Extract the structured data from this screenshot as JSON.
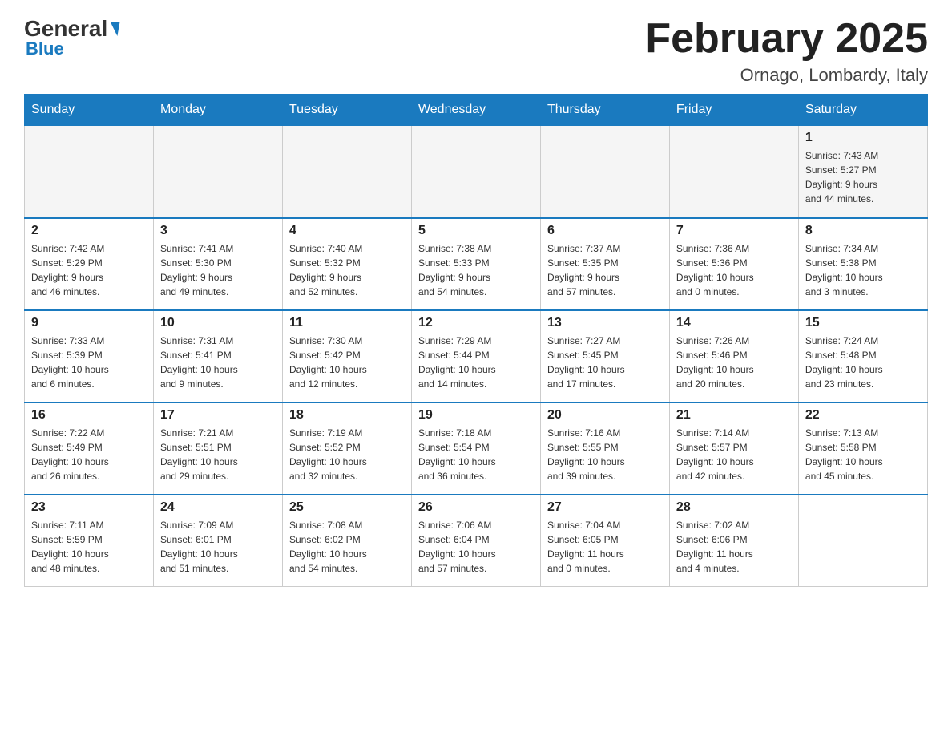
{
  "header": {
    "logo": {
      "general": "General",
      "blue": "Blue"
    },
    "title": "February 2025",
    "location": "Ornago, Lombardy, Italy"
  },
  "weekdays": [
    "Sunday",
    "Monday",
    "Tuesday",
    "Wednesday",
    "Thursday",
    "Friday",
    "Saturday"
  ],
  "weeks": [
    [
      {
        "day": "",
        "info": ""
      },
      {
        "day": "",
        "info": ""
      },
      {
        "day": "",
        "info": ""
      },
      {
        "day": "",
        "info": ""
      },
      {
        "day": "",
        "info": ""
      },
      {
        "day": "",
        "info": ""
      },
      {
        "day": "1",
        "info": "Sunrise: 7:43 AM\nSunset: 5:27 PM\nDaylight: 9 hours\nand 44 minutes."
      }
    ],
    [
      {
        "day": "2",
        "info": "Sunrise: 7:42 AM\nSunset: 5:29 PM\nDaylight: 9 hours\nand 46 minutes."
      },
      {
        "day": "3",
        "info": "Sunrise: 7:41 AM\nSunset: 5:30 PM\nDaylight: 9 hours\nand 49 minutes."
      },
      {
        "day": "4",
        "info": "Sunrise: 7:40 AM\nSunset: 5:32 PM\nDaylight: 9 hours\nand 52 minutes."
      },
      {
        "day": "5",
        "info": "Sunrise: 7:38 AM\nSunset: 5:33 PM\nDaylight: 9 hours\nand 54 minutes."
      },
      {
        "day": "6",
        "info": "Sunrise: 7:37 AM\nSunset: 5:35 PM\nDaylight: 9 hours\nand 57 minutes."
      },
      {
        "day": "7",
        "info": "Sunrise: 7:36 AM\nSunset: 5:36 PM\nDaylight: 10 hours\nand 0 minutes."
      },
      {
        "day": "8",
        "info": "Sunrise: 7:34 AM\nSunset: 5:38 PM\nDaylight: 10 hours\nand 3 minutes."
      }
    ],
    [
      {
        "day": "9",
        "info": "Sunrise: 7:33 AM\nSunset: 5:39 PM\nDaylight: 10 hours\nand 6 minutes."
      },
      {
        "day": "10",
        "info": "Sunrise: 7:31 AM\nSunset: 5:41 PM\nDaylight: 10 hours\nand 9 minutes."
      },
      {
        "day": "11",
        "info": "Sunrise: 7:30 AM\nSunset: 5:42 PM\nDaylight: 10 hours\nand 12 minutes."
      },
      {
        "day": "12",
        "info": "Sunrise: 7:29 AM\nSunset: 5:44 PM\nDaylight: 10 hours\nand 14 minutes."
      },
      {
        "day": "13",
        "info": "Sunrise: 7:27 AM\nSunset: 5:45 PM\nDaylight: 10 hours\nand 17 minutes."
      },
      {
        "day": "14",
        "info": "Sunrise: 7:26 AM\nSunset: 5:46 PM\nDaylight: 10 hours\nand 20 minutes."
      },
      {
        "day": "15",
        "info": "Sunrise: 7:24 AM\nSunset: 5:48 PM\nDaylight: 10 hours\nand 23 minutes."
      }
    ],
    [
      {
        "day": "16",
        "info": "Sunrise: 7:22 AM\nSunset: 5:49 PM\nDaylight: 10 hours\nand 26 minutes."
      },
      {
        "day": "17",
        "info": "Sunrise: 7:21 AM\nSunset: 5:51 PM\nDaylight: 10 hours\nand 29 minutes."
      },
      {
        "day": "18",
        "info": "Sunrise: 7:19 AM\nSunset: 5:52 PM\nDaylight: 10 hours\nand 32 minutes."
      },
      {
        "day": "19",
        "info": "Sunrise: 7:18 AM\nSunset: 5:54 PM\nDaylight: 10 hours\nand 36 minutes."
      },
      {
        "day": "20",
        "info": "Sunrise: 7:16 AM\nSunset: 5:55 PM\nDaylight: 10 hours\nand 39 minutes."
      },
      {
        "day": "21",
        "info": "Sunrise: 7:14 AM\nSunset: 5:57 PM\nDaylight: 10 hours\nand 42 minutes."
      },
      {
        "day": "22",
        "info": "Sunrise: 7:13 AM\nSunset: 5:58 PM\nDaylight: 10 hours\nand 45 minutes."
      }
    ],
    [
      {
        "day": "23",
        "info": "Sunrise: 7:11 AM\nSunset: 5:59 PM\nDaylight: 10 hours\nand 48 minutes."
      },
      {
        "day": "24",
        "info": "Sunrise: 7:09 AM\nSunset: 6:01 PM\nDaylight: 10 hours\nand 51 minutes."
      },
      {
        "day": "25",
        "info": "Sunrise: 7:08 AM\nSunset: 6:02 PM\nDaylight: 10 hours\nand 54 minutes."
      },
      {
        "day": "26",
        "info": "Sunrise: 7:06 AM\nSunset: 6:04 PM\nDaylight: 10 hours\nand 57 minutes."
      },
      {
        "day": "27",
        "info": "Sunrise: 7:04 AM\nSunset: 6:05 PM\nDaylight: 11 hours\nand 0 minutes."
      },
      {
        "day": "28",
        "info": "Sunrise: 7:02 AM\nSunset: 6:06 PM\nDaylight: 11 hours\nand 4 minutes."
      },
      {
        "day": "",
        "info": ""
      }
    ]
  ]
}
